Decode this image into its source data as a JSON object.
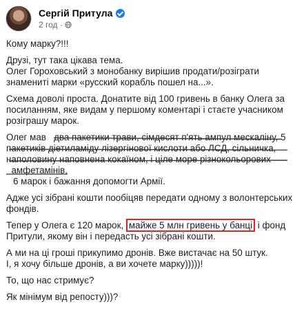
{
  "author": {
    "name": "Сергій Притула",
    "time": "2 год ·"
  },
  "post": {
    "p1": "Кому марку?!!!",
    "p2": [
      "Друзі, тут така цікава тема.",
      "Олег Гороховський з монобанку вирішив продати/розіграти",
      "знамениті марки «русский корабль пошел на...»."
    ],
    "p3": [
      "Схема доволі проста. Донатите від 100 гривень в банку Олега за",
      "посиланням, яке видам у першому коментарі і стаєте учасником",
      "розіграшу марок."
    ],
    "p4_prefix": "Олег мав",
    "p4_strike": [
      "два пакетики трави, сімдесят п'ять ампул мескаліну, 5",
      "пакетиків діетиламіду лізергінової кислоти або ЛСД, сільничка,",
      "наполовину наповнена кокаїном, і ціле море різнокольорових",
      "амфетамінів,"
    ],
    "p4_end": "6 марок і бажання допомогти Армії.",
    "p5": [
      "Адже усі зібрані кошти пообіцяв передати одному з волонтерських",
      "фондів."
    ],
    "p6_pre": "Тепер у Олега є 120 марок,",
    "p6_box": "майже 5 млн гривень у банці",
    "p6_post": "і фонд",
    "p6_line2": "Притули, якому він і передасть усі зібрані кошти.",
    "p7": [
      "А ми на ці гроші прикупимо дронів. Вже вистачає на 50 штук.",
      "І, я хочу більше дронів, а ви хочете марку)))))!"
    ],
    "p8": "То, що нас стримує?",
    "p9": "Як мінімум від репосту)))?"
  },
  "colors": {
    "accent": "#1877f2",
    "highlight_box": "#d9262b",
    "meta": "#65676b"
  },
  "icons": {
    "verified": "verified-badge-icon",
    "audience": "globe-icon"
  }
}
